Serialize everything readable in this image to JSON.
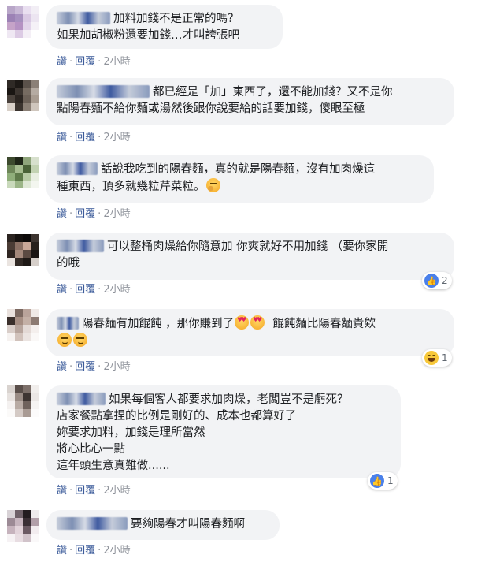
{
  "actions": {
    "like": "讚",
    "reply": "回覆",
    "separator": "·"
  },
  "colors": {
    "link": "#385898",
    "bubble": "#f2f3f5",
    "like": "#4a80ea",
    "haha": "#f7c83a"
  },
  "comments": [
    {
      "lines": [
        "加料加錢不是正常的嗎？",
        "如果加胡椒粉還要加錢…才叫誇張吧"
      ],
      "time": "2小時"
    },
    {
      "lines": [
        "都已經是「加」東西了，還不能加錢？又不是你",
        "點陽春麵不給你麵或湯然後跟你說要給的話要加錢，傻眼至極"
      ],
      "time": "2小時"
    },
    {
      "lines": [
        "話說我吃到的陽春麵，真的就是陽春麵，沒有加肉燥這",
        "種東西，頂多就幾粒芹菜粒。"
      ],
      "emoji_end": "thinking-face-icon",
      "time": "2小時"
    },
    {
      "lines": [
        "可以整桶肉燥給你隨意加 你爽就好不用加錢 （要你家開",
        "的哦"
      ],
      "time": "2小時",
      "reaction": {
        "icon": "like-icon",
        "count": "2"
      }
    },
    {
      "lines": [
        "陽春麵有加餛飩 ，那你賺到了",
        "餛飩麵比陽春麵貴欸"
      ],
      "time": "2小時",
      "reaction": {
        "icon": "haha-icon",
        "count": "1"
      }
    },
    {
      "lines": [
        "如果每個客人都要求加肉燥，老闆豈不是虧死？",
        "店家餐點拿捏的比例是剛好的、成本也都算好了",
        "妳要求加料，加錢是理所當然",
        "將心比心一點",
        "這年頭生意真難做......"
      ],
      "time": "2小時",
      "reaction": {
        "icon": "like-icon",
        "count": "1"
      }
    },
    {
      "lines": [
        "要夠陽春才叫陽春麵啊"
      ],
      "time": "2小時"
    }
  ]
}
